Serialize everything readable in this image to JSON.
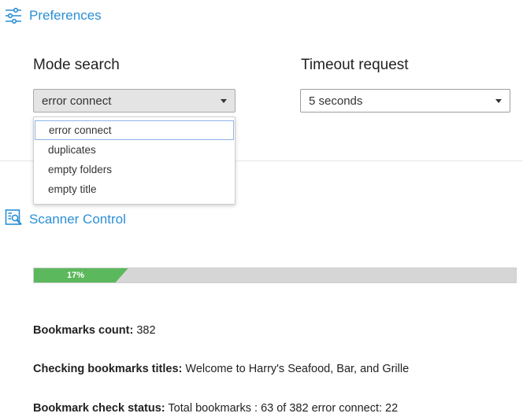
{
  "preferences": {
    "title": "Preferences",
    "mode_search": {
      "label": "Mode search",
      "selected": "error connect",
      "options": [
        "error connect",
        "duplicates",
        "empty folders",
        "empty title"
      ]
    },
    "timeout_request": {
      "label": "Timeout request",
      "selected": "5 seconds"
    }
  },
  "scanner": {
    "title": "Scanner Control",
    "progress_percent": 17,
    "progress_label": "17%",
    "bookmarks_count_label": "Bookmarks count:",
    "bookmarks_count_value": "382",
    "checking_label": "Checking bookmarks titles:",
    "checking_value": "Welcome to Harry's Seafood, Bar, and Grille",
    "check_status_label": "Bookmark check status:",
    "check_status_value": "Total bookmarks : 63 of 382 error connect: 22"
  },
  "colors": {
    "accent": "#2a8fd6",
    "progress_fill": "#5cb85c",
    "progress_track": "#d6d6d6"
  },
  "icons": {
    "preferences": "sliders-icon",
    "scanner": "scanner-document-icon"
  }
}
